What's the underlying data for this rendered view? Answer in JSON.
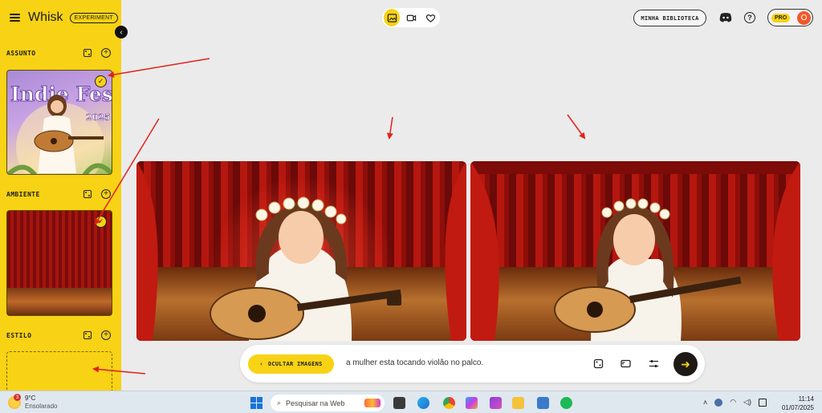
{
  "app": {
    "name": "Whisk",
    "badge": "EXPERIMENT"
  },
  "sidebar": {
    "sections": [
      {
        "title": "ASSUNTO"
      },
      {
        "title": "AMBIENTE"
      },
      {
        "title": "ESTILO"
      }
    ],
    "subject_image_text": {
      "line1": "Indie Fest",
      "line2": "2025"
    }
  },
  "header": {
    "modes": [
      "image-mode",
      "video-mode",
      "favorites"
    ],
    "library_label": "MINHA BIBLIOTECA",
    "pro_label": "PRO",
    "avatar_initial": "O"
  },
  "prompt_bar": {
    "hide_images_label": "OCULTAR IMAGENS",
    "prompt_text": "a mulher esta tocando violão no palco."
  },
  "taskbar": {
    "weather_temp": "9°C",
    "weather_desc": "Ensolarado",
    "weather_badge": "3",
    "search_placeholder": "Pesquisar na Web",
    "time": "11:14",
    "date": "01/07/2025"
  },
  "colors": {
    "accent": "#f8d214",
    "annotation": "#e0221b",
    "send_button": "#1e1a16"
  }
}
